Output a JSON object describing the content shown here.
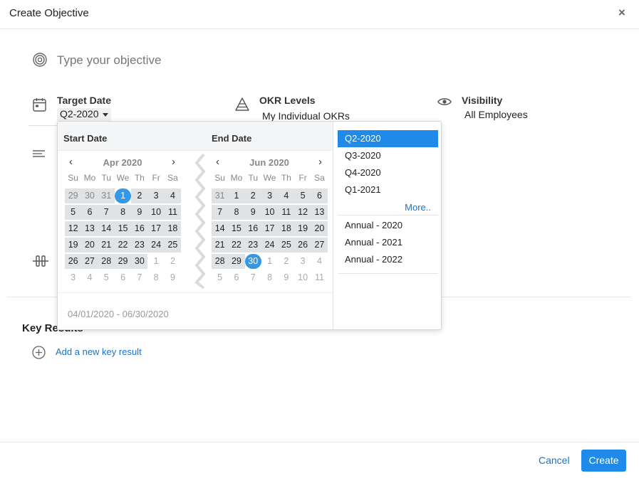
{
  "dialog": {
    "title": "Create Objective",
    "close": "×"
  },
  "objective": {
    "placeholder": "Type your objective"
  },
  "target_date": {
    "label": "Target Date",
    "value": "Q2-2020"
  },
  "okr_levels": {
    "label": "OKR Levels",
    "value": "My Individual OKRs"
  },
  "visibility": {
    "label": "Visibility",
    "value": "All Employees"
  },
  "picker": {
    "start_header": "Start Date",
    "end_header": "End Date",
    "weekdays": [
      "Su",
      "Mo",
      "Tu",
      "We",
      "Th",
      "Fr",
      "Sa"
    ],
    "start_month": "Apr 2020",
    "end_month": "Jun 2020",
    "range_text": "04/01/2020 - 06/30/2020",
    "presets": [
      "Q2-2020",
      "Q3-2020",
      "Q4-2020",
      "Q1-2021"
    ],
    "more": "More..",
    "annual": [
      "Annual - 2020",
      "Annual - 2021",
      "Annual - 2022"
    ],
    "start_days": [
      [
        29,
        30,
        31,
        1,
        2,
        3,
        4
      ],
      [
        5,
        6,
        7,
        8,
        9,
        10,
        11
      ],
      [
        12,
        13,
        14,
        15,
        16,
        17,
        18
      ],
      [
        19,
        20,
        21,
        22,
        23,
        24,
        25
      ],
      [
        26,
        27,
        28,
        29,
        30,
        1,
        2
      ],
      [
        3,
        4,
        5,
        6,
        7,
        8,
        9
      ]
    ],
    "end_days": [
      [
        31,
        1,
        2,
        3,
        4,
        5,
        6
      ],
      [
        7,
        8,
        9,
        10,
        11,
        12,
        13
      ],
      [
        14,
        15,
        16,
        17,
        18,
        19,
        20
      ],
      [
        21,
        22,
        23,
        24,
        25,
        26,
        27
      ],
      [
        28,
        29,
        30,
        1,
        2,
        3,
        4
      ],
      [
        5,
        6,
        7,
        8,
        9,
        10,
        11
      ]
    ]
  },
  "key_results": {
    "title": "Key Results",
    "add": "Add a new key result"
  },
  "footer": {
    "cancel": "Cancel",
    "create": "Create"
  },
  "colors": {
    "accent": "#1f8ae8",
    "link": "#1a73c8",
    "selected_day": "#3399e6",
    "range_fill": "#e0e3e6"
  }
}
